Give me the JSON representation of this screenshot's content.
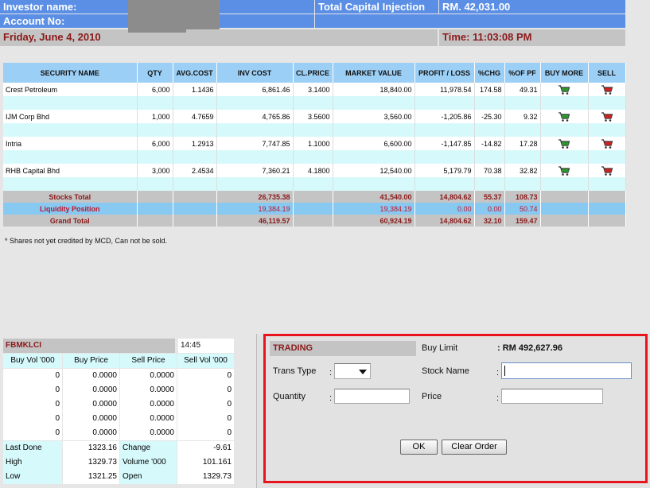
{
  "header": {
    "investor_label": "Investor name:",
    "account_label": "Account No:",
    "capital_label": "Total Capital Injection",
    "capital_value": "RM. 42,031.00",
    "date": "Friday, June 4, 2010",
    "time": "Time: 11:03:08 PM"
  },
  "portfolio": {
    "columns": [
      "SECURITY NAME",
      "QTY",
      "AVG.COST",
      "INV COST",
      "CL.PRICE",
      "MARKET VALUE",
      "PROFIT / LOSS",
      "%CHG",
      "%OF PF",
      "BUY MORE",
      "SELL"
    ],
    "rows": [
      {
        "name": "Crest Petroleum",
        "qty": "6,000",
        "avg": "1.1436",
        "inv": "6,861.46",
        "cl": "3.1400",
        "mv": "18,840.00",
        "pl": "11,978.54",
        "chg": "174.58",
        "pf": "49.31"
      },
      {
        "name": "IJM Corp Bhd",
        "qty": "1,000",
        "avg": "4.7659",
        "inv": "4,765.86",
        "cl": "3.5600",
        "mv": "3,560.00",
        "pl": "-1,205.86",
        "chg": "-25.30",
        "pf": "9.32"
      },
      {
        "name": "Intria",
        "qty": "6,000",
        "avg": "1.2913",
        "inv": "7,747.85",
        "cl": "1.1000",
        "mv": "6,600.00",
        "pl": "-1,147.85",
        "chg": "-14.82",
        "pf": "17.28"
      },
      {
        "name": "RHB Capital Bhd",
        "qty": "3,000",
        "avg": "2.4534",
        "inv": "7,360.21",
        "cl": "4.1800",
        "mv": "12,540.00",
        "pl": "5,179.79",
        "chg": "70.38",
        "pf": "32.82"
      }
    ],
    "stocks_total": {
      "label": "Stocks Total",
      "inv": "26,735.38",
      "mv": "41,540.00",
      "pl": "14,804.62",
      "chg": "55.37",
      "pf": "108.73"
    },
    "liquidity": {
      "label": "Liquidity Position",
      "inv": "19,384.19",
      "mv": "19,384.19",
      "pl": "0.00",
      "chg": "0.00",
      "pf": "50.74"
    },
    "grand_total": {
      "label": "Grand Total",
      "inv": "46,119.57",
      "mv": "60,924.19",
      "pl": "14,804.62",
      "chg": "32.10",
      "pf": "159.47"
    },
    "footnote": "* Shares not yet credited by MCD, Can not be sold."
  },
  "index": {
    "name": "FBMKLCI",
    "time": "14:45",
    "headers": [
      "Buy Vol '000",
      "Buy Price",
      "Sell Price",
      "Sell Vol '000"
    ],
    "depth": [
      [
        "0",
        "0.0000",
        "0.0000",
        "0"
      ],
      [
        "0",
        "0.0000",
        "0.0000",
        "0"
      ],
      [
        "0",
        "0.0000",
        "0.0000",
        "0"
      ],
      [
        "0",
        "0.0000",
        "0.0000",
        "0"
      ],
      [
        "0",
        "0.0000",
        "0.0000",
        "0"
      ]
    ],
    "stats": [
      [
        "Last Done",
        "1323.16",
        "Change",
        "-9.61"
      ],
      [
        "High",
        "1329.73",
        "Volume '000",
        "101.161"
      ],
      [
        "Low",
        "1321.25",
        "Open",
        "1329.73"
      ]
    ]
  },
  "trading": {
    "title": "TRADING",
    "buy_limit_label": "Buy Limit",
    "buy_limit_value": ": RM 492,627.96",
    "trans_type_label": "Trans Type",
    "trans_type_value": "",
    "stock_name_label": "Stock Name",
    "stock_name_value": "",
    "quantity_label": "Quantity",
    "quantity_value": "",
    "price_label": "Price",
    "price_value": "",
    "colon": ":",
    "ok_label": "OK",
    "clear_label": "Clear Order"
  },
  "colors": {
    "header_blue": "#5b8fe6",
    "table_header": "#9ccff5",
    "row_alt": "#d6fafc",
    "total_text": "#8b1a1a",
    "liquidity_text": "#c0142a",
    "frame_red": "#e8141e",
    "buy_cart": "#2e9a2e",
    "sell_cart": "#d42020"
  },
  "icons": {
    "buy": "buy-cart-icon",
    "sell": "sell-cart-icon",
    "dropdown": "chevron-down-icon"
  }
}
